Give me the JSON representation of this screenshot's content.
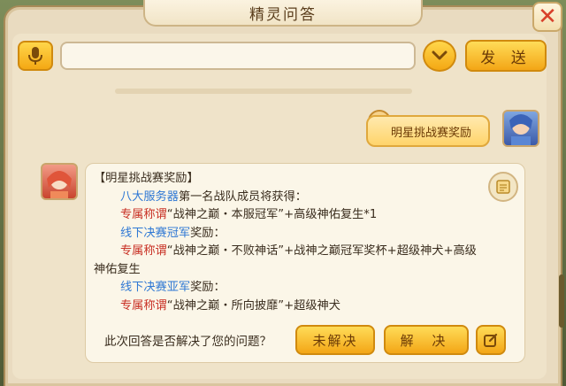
{
  "window": {
    "title": "精灵问答"
  },
  "input_bar": {
    "placeholder": "",
    "value": "",
    "send_label": "发 送"
  },
  "conversation": {
    "user_message": "明星挑战赛奖励",
    "reply_lines": [
      {
        "parts": [
          {
            "text": "【明星挑战赛奖励】",
            "style": "normal"
          }
        ],
        "indent": false
      },
      {
        "parts": [
          {
            "text": "八大服务器",
            "style": "blue"
          },
          {
            "text": "第一名战队成员将获得：",
            "style": "normal"
          }
        ],
        "indent": true
      },
      {
        "parts": [
          {
            "text": "专属称谓",
            "style": "red"
          },
          {
            "text": "“战神之巅・本服冠军”+高级神佑复生*1",
            "style": "normal"
          }
        ],
        "indent": true
      },
      {
        "parts": [
          {
            "text": "线下决赛冠军",
            "style": "blue"
          },
          {
            "text": "奖励：",
            "style": "normal"
          }
        ],
        "indent": true
      },
      {
        "parts": [
          {
            "text": "专属称谓",
            "style": "red"
          },
          {
            "text": "“战神之巅・不败神话”+战神之巅冠军奖杯+超级神犬+高级",
            "style": "normal"
          }
        ],
        "indent": true
      },
      {
        "parts": [
          {
            "text": "神佑复生",
            "style": "normal"
          }
        ],
        "indent": false
      },
      {
        "parts": [
          {
            "text": "线下决赛亚军",
            "style": "blue"
          },
          {
            "text": "奖励：",
            "style": "normal"
          }
        ],
        "indent": true
      },
      {
        "parts": [
          {
            "text": "专属称谓",
            "style": "red"
          },
          {
            "text": "“战神之巅・所向披靡”+超级神犬",
            "style": "normal"
          }
        ],
        "indent": true
      }
    ]
  },
  "feedback": {
    "question": "此次回答是否解决了您的问题？",
    "unresolved_label": "未解决",
    "resolved_label": "解 决"
  },
  "colors": {
    "accent": "#f4a814",
    "link_blue": "#2f78d4",
    "highlight_red": "#c83024"
  }
}
